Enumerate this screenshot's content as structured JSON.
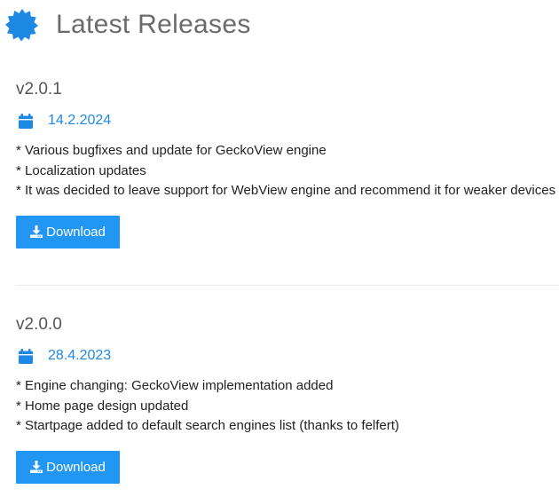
{
  "header": {
    "title": "Latest Releases",
    "logo_icon": "gear-badge-icon",
    "logo_color": "#1e88e5"
  },
  "releases": [
    {
      "version": "v2.0.1",
      "date": "14.2.2024",
      "notes": [
        "* Various bugfixes and update for GeckoView engine",
        "* Localization updates",
        "* It was decided to leave support for WebView engine and recommend it for weaker devices"
      ],
      "download_label": "Download"
    },
    {
      "version": "v2.0.0",
      "date": "28.4.2023",
      "notes": [
        "* Engine changing: GeckoView implementation added",
        "* Home page design updated",
        "* Startpage added to default search engines list (thanks to felfert)"
      ],
      "download_label": "Download"
    }
  ],
  "icons": {
    "date": "calendar-icon",
    "download": "download-icon"
  },
  "colors": {
    "accent": "#1e88e5",
    "button": "#2196f3",
    "title": "#6b6b6b"
  }
}
